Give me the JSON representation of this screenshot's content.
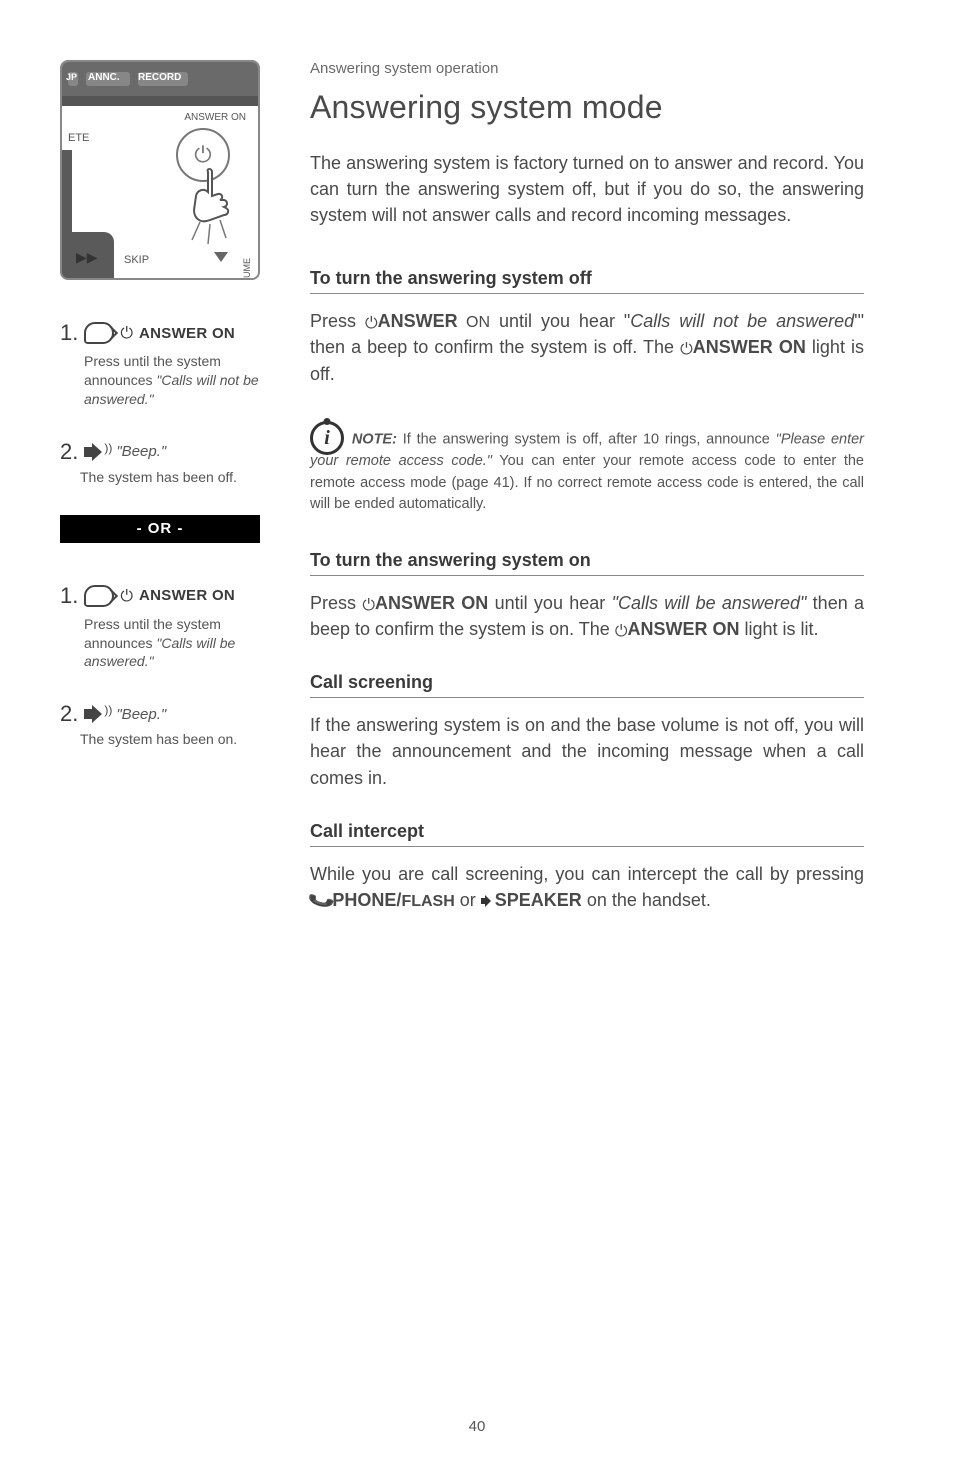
{
  "breadcrumb": "Answering system operation",
  "title": "Answering system mode",
  "intro": "The answering system is factory turned on to answer and record. You can turn the answering system off, but if you do so, the answering system will not answer calls and record incoming messages.",
  "device": {
    "top_labels": {
      "jp": "JP",
      "annc": "ANNC.",
      "record": "RECORD"
    },
    "ete": "ETE",
    "answer_on": "ANSWER ON",
    "skip": "SKIP",
    "volume": "VOLUME",
    "play": "▶▶"
  },
  "left": {
    "off": {
      "step1": {
        "num": "1.",
        "label": " ANSWER ON",
        "body_pre": "Press until the system announces ",
        "body_ital": "\"Calls will not be answered.\""
      },
      "step2": {
        "num": "2.",
        "beep": "\"Beep.\"",
        "sub": "The system has been off."
      }
    },
    "or": "- OR -",
    "on": {
      "step1": {
        "num": "1.",
        "label": "ANSWER ON",
        "body_pre": "Press until the system announces ",
        "body_ital": "\"Calls will be answered.\""
      },
      "step2": {
        "num": "2.",
        "beep": "\"Beep.\"",
        "sub": "The system has been on."
      }
    }
  },
  "sections": {
    "off": {
      "heading": "To turn the answering system off",
      "p1_a": "Press ",
      "p1_b": "ANSWER",
      "p1_c": " ON",
      "p1_d": " until you hear \"",
      "p1_e": "Calls will not be answered",
      "p1_f": "'\" then a beep to confirm the system is off. The ",
      "p1_g": "ANSWER ON",
      "p1_h": " light is off."
    },
    "note": {
      "label": "NOTE:",
      "a": " If the answering system is off, after 10 rings, announce ",
      "b": "\"Please enter your remote access code.\"",
      "c": " You can enter your remote access code to enter the remote access mode (page 41). If no correct remote access code is entered, the call will be ended automatically."
    },
    "on": {
      "heading": "To turn the answering system on",
      "p1_a": "Press ",
      "p1_b": "ANSWER ON",
      "p1_c": " until you hear ",
      "p1_d": "\"Calls will be answered\"",
      "p1_e": " then a beep to confirm the system is on. The ",
      "p1_f": "ANSWER ON",
      "p1_g": " light is lit."
    },
    "screening": {
      "heading": "Call screening",
      "body": "If the answering system is on and the base volume is not off, you will hear the announcement and the incoming message when a call comes in."
    },
    "intercept": {
      "heading": "Call intercept",
      "a": "While you are call screening, you can intercept the call by pressing ",
      "b": "PHONE/",
      "c": "FLASH",
      "d": " or ",
      "e": "SPEAKER",
      "f": " on the handset."
    }
  },
  "page_number": "40",
  "glyphs": {
    "power": "⏻"
  }
}
